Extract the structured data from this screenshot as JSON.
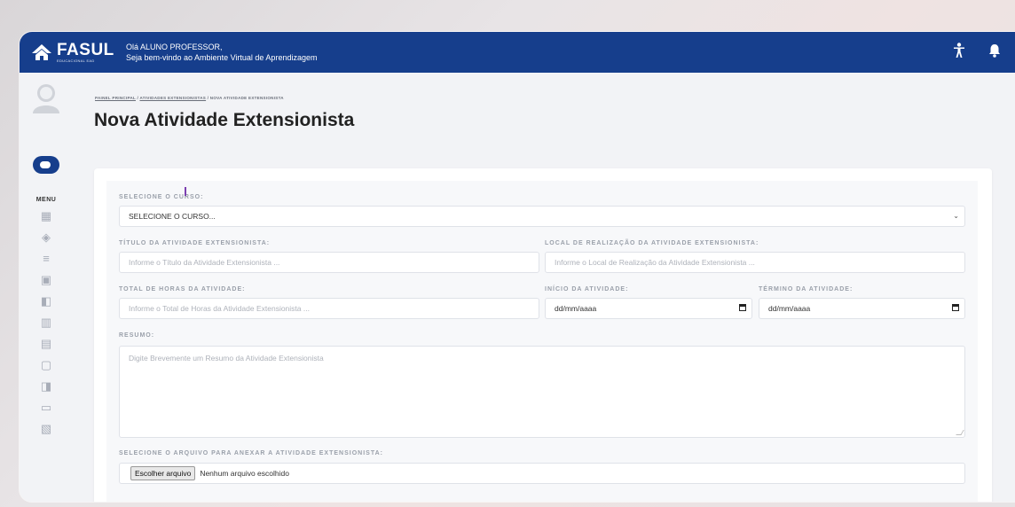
{
  "header": {
    "logo_name": "FASUL",
    "logo_sub": "EDUCACIONAL EAD",
    "greeting_line1": "Olá ALUNO PROFESSOR,",
    "greeting_line2": "Seja bem-vindo ao Ambiente Virtual de Aprendizagem",
    "brand_color": "#163e8c"
  },
  "sidebar": {
    "menu_label": "MENU",
    "icons": [
      "dashboard-icon",
      "graduation-cap-icon",
      "list-icon",
      "dollar-icon",
      "book-icon",
      "briefcase-icon",
      "document-icon",
      "calendar-icon",
      "book-open-icon",
      "mail-icon",
      "chat-icon"
    ]
  },
  "breadcrumb": {
    "items": [
      "PAINEL PRINCIPAL",
      "ATIVIDADES EXTENSIONISTAS",
      "NOVA ATIVIDADE EXTENSIONISTA"
    ],
    "separator": "/"
  },
  "page": {
    "title": "Nova Atividade Extensionista"
  },
  "form": {
    "curso_label": "SELECIONE O CURSO:",
    "curso_value": "SELECIONE O CURSO...",
    "titulo_label": "TÍTULO DA ATIVIDADE EXTENSIONISTA:",
    "titulo_placeholder": "Informe o Título da Atividade Extensionista ...",
    "local_label": "LOCAL DE REALIZAÇÃO DA ATIVIDADE EXTENSIONISTA:",
    "local_placeholder": "Informe o Local de Realização da Atividade Extensionista ...",
    "horas_label": "TOTAL DE HORAS DA ATIVIDADE:",
    "horas_placeholder": "Informe o Total de Horas da Atividade Extensionista ...",
    "inicio_label": "INÍCIO DA ATIVIDADE:",
    "inicio_value": "dd/mm/aaaa",
    "termino_label": "TÉRMINO DA ATIVIDADE:",
    "termino_value": "dd/mm/aaaa",
    "resumo_label": "RESUMO:",
    "resumo_placeholder": "Digite Brevemente um Resumo da Atividade Extensionista",
    "arquivo_label": "SELECIONE O ARQUIVO PARA ANEXAR A ATIVIDADE EXTENSIONISTA:",
    "arquivo_button": "Escolher arquivo",
    "arquivo_status": "Nenhum arquivo escolhido"
  }
}
